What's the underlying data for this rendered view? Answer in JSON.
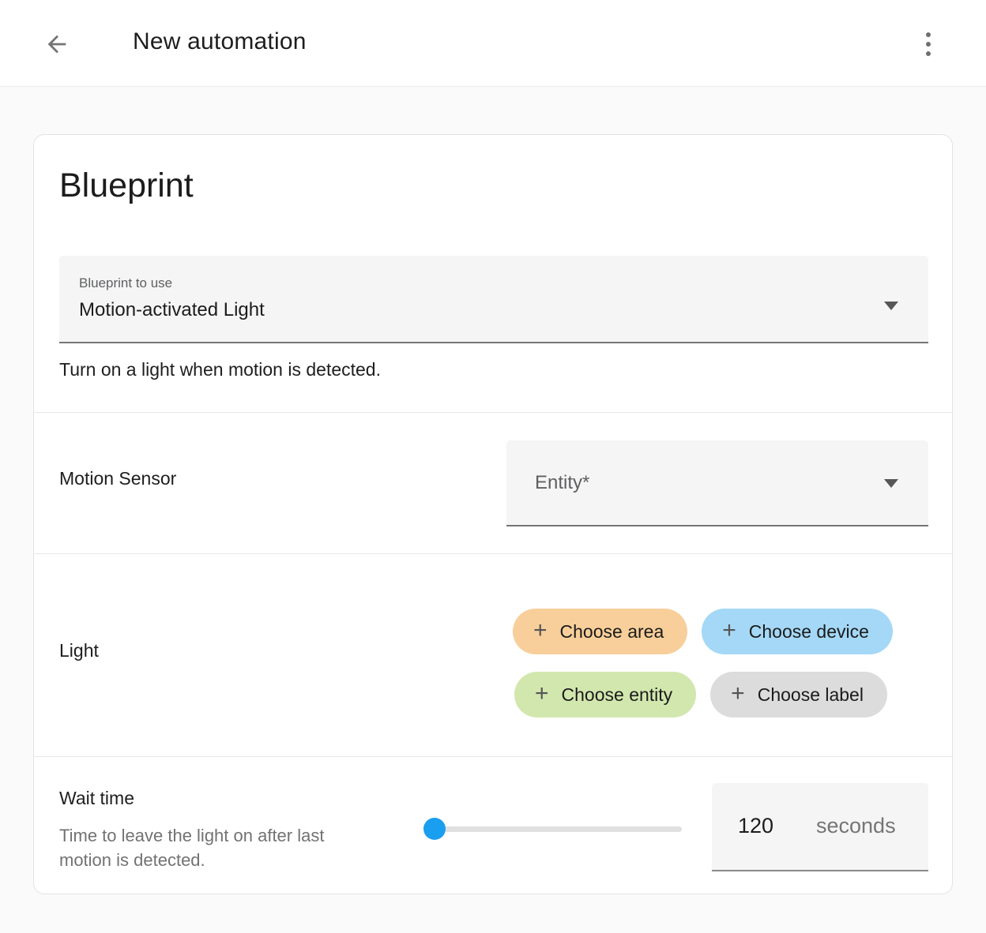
{
  "header": {
    "title": "New automation",
    "back_icon": "arrow-left",
    "menu_icon": "kebab-vertical"
  },
  "card": {
    "title": "Blueprint",
    "blueprint_field": {
      "label": "Blueprint to use",
      "value": "Motion-activated Light"
    },
    "description": "Turn on a light when motion is detected.",
    "motion_sensor": {
      "label": "Motion Sensor",
      "entity_placeholder": "Entity*"
    },
    "light": {
      "label": "Light",
      "chips": [
        {
          "label": "Choose area",
          "color": "#f8cf9a",
          "icon": "plus"
        },
        {
          "label": "Choose device",
          "color": "#a4d8f6",
          "icon": "plus"
        },
        {
          "label": "Choose entity",
          "color": "#d2e7ae",
          "icon": "plus"
        },
        {
          "label": "Choose label",
          "color": "#dcdcdc",
          "icon": "plus"
        }
      ]
    },
    "wait_time": {
      "label": "Wait time",
      "description": "Time to leave the light on after last motion is detected.",
      "value": "120",
      "unit": "seconds",
      "slider_percent": 0
    }
  },
  "colors": {
    "slider_thumb": "#1a9ef0",
    "slider_track": "#e0e0e0",
    "icon_gray": "#757575"
  },
  "icons": {
    "plus_glyph": "+"
  }
}
